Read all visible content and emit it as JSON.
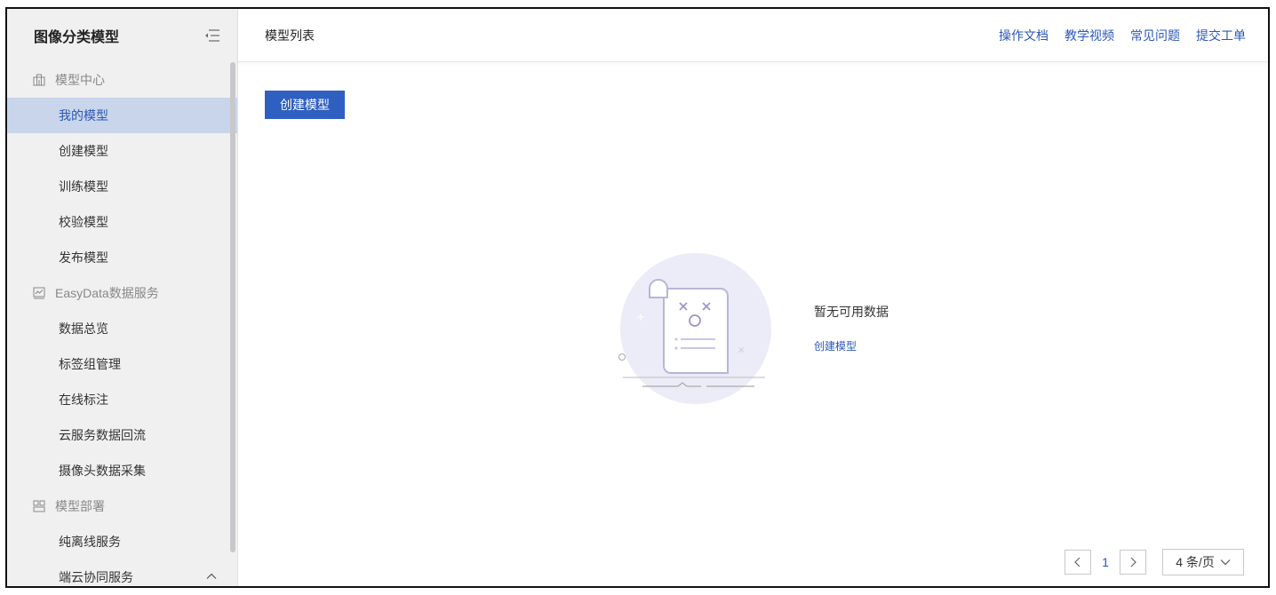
{
  "sidebar": {
    "title": "图像分类模型",
    "groups": [
      {
        "label": "模型中心",
        "icon": "building-icon",
        "items": [
          "我的模型",
          "创建模型",
          "训练模型",
          "校验模型",
          "发布模型"
        ]
      },
      {
        "label": "EasyData数据服务",
        "icon": "chart-icon",
        "items": [
          "数据总览",
          "标签组管理",
          "在线标注",
          "云服务数据回流",
          "摄像头数据采集"
        ]
      },
      {
        "label": "模型部署",
        "icon": "deploy-icon",
        "items": [
          "纯离线服务",
          "端云协同服务"
        ]
      }
    ],
    "active_item": "我的模型"
  },
  "header": {
    "title": "模型列表",
    "links": [
      "操作文档",
      "教学视频",
      "常见问题",
      "提交工单"
    ]
  },
  "main": {
    "create_button": "创建模型",
    "empty_text": "暂无可用数据",
    "empty_link": "创建模型"
  },
  "pagination": {
    "current_page": "1",
    "page_size": "4 条/页"
  },
  "colors": {
    "accent": "#2f5fc0",
    "link": "#2b58b8",
    "active_bg": "#c9d5ea",
    "sidebar_bg": "#f0f0f1",
    "illustration_circle": "#ecebf8"
  }
}
